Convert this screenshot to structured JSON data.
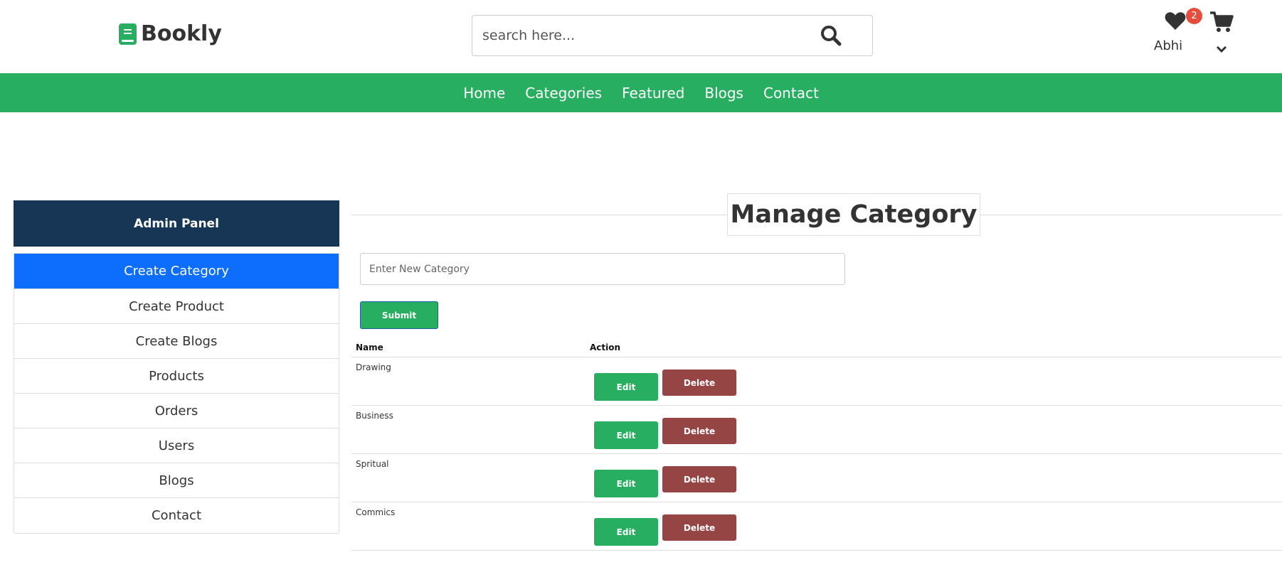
{
  "brand": {
    "name": "Bookly",
    "logo_icon": "book-icon"
  },
  "search": {
    "placeholder": "search here...",
    "icon": "search-icon"
  },
  "user": {
    "wishlist_count": "2",
    "name": "Abhi"
  },
  "nav": {
    "links": [
      "Home",
      "Categories",
      "Featured",
      "Blogs",
      "Contact"
    ]
  },
  "sidebar": {
    "title": "Admin Panel",
    "items": [
      {
        "label": "Create Category",
        "active": true
      },
      {
        "label": "Create Product"
      },
      {
        "label": "Create Blogs"
      },
      {
        "label": "Products"
      },
      {
        "label": "Orders"
      },
      {
        "label": "Users"
      },
      {
        "label": "Blogs"
      },
      {
        "label": "Contact"
      }
    ]
  },
  "main": {
    "title": "Manage Category",
    "input_placeholder": "Enter New Category",
    "submit_label": "Submit",
    "table": {
      "headers": [
        "Name",
        "Action"
      ],
      "rows": [
        {
          "name": "Drawing",
          "edit": "Edit",
          "delete": "Delete"
        },
        {
          "name": "Business",
          "edit": "Edit",
          "delete": "Delete"
        },
        {
          "name": "Spritual",
          "edit": "Edit",
          "delete": "Delete"
        },
        {
          "name": "Commics",
          "edit": "Edit",
          "delete": "Delete"
        }
      ]
    }
  },
  "colors": {
    "brand_green": "#27ae60",
    "sidebar_header": "#173656",
    "active_item": "#0d6efd",
    "delete_button": "#964545",
    "badge": "#e74c3c"
  }
}
